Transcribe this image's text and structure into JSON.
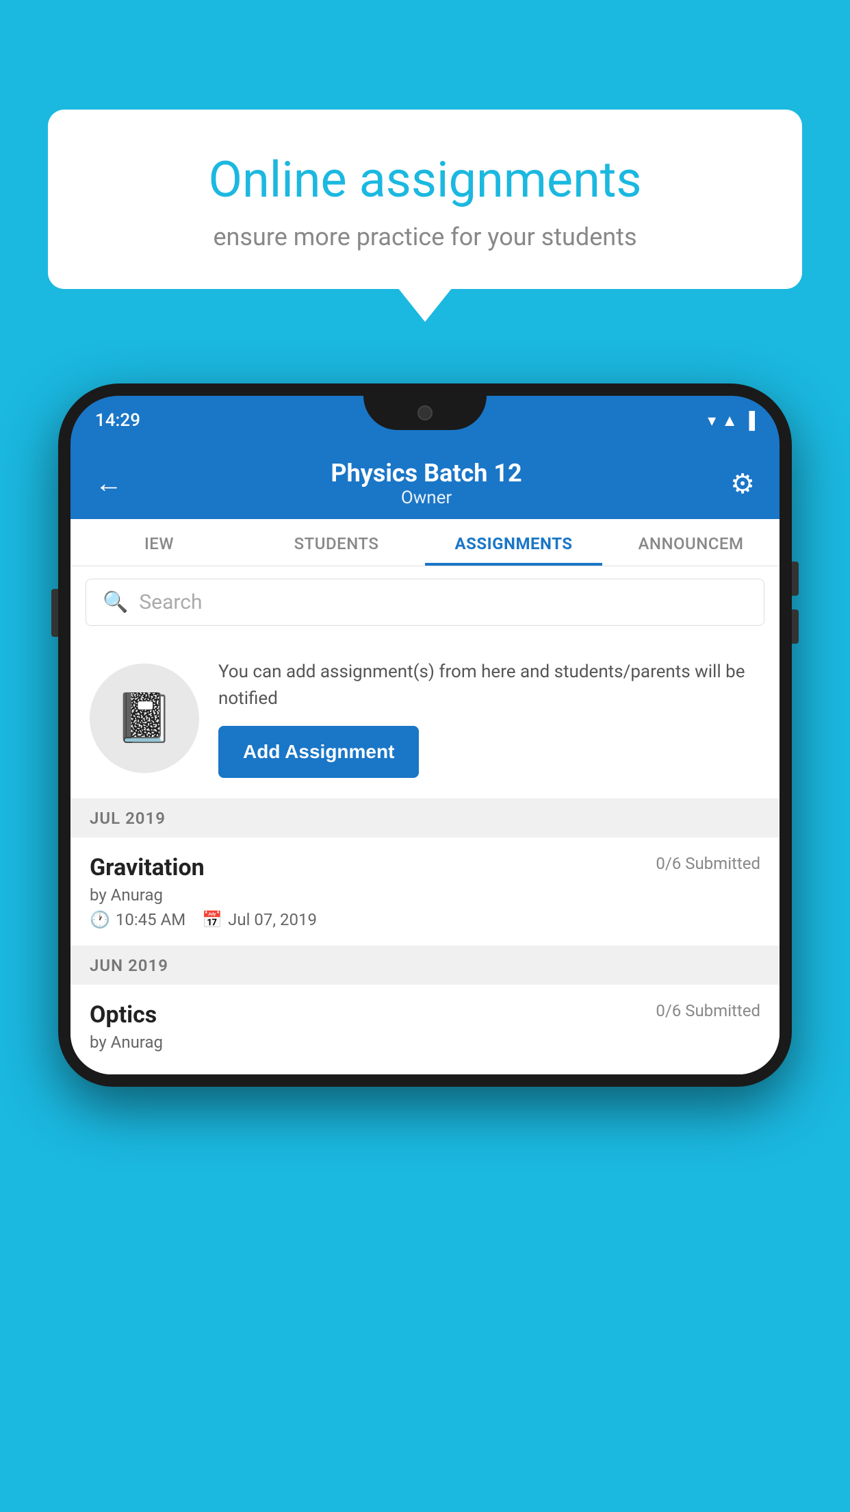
{
  "background_color": "#1bb8e0",
  "speech_bubble": {
    "title": "Online assignments",
    "subtitle": "ensure more practice for your students"
  },
  "phone": {
    "status_bar": {
      "time": "14:29",
      "icons": [
        "wifi",
        "signal",
        "battery"
      ]
    },
    "header": {
      "title": "Physics Batch 12",
      "subtitle": "Owner",
      "back_label": "←",
      "settings_label": "⚙"
    },
    "tabs": [
      {
        "label": "IEW",
        "active": false
      },
      {
        "label": "STUDENTS",
        "active": false
      },
      {
        "label": "ASSIGNMENTS",
        "active": true
      },
      {
        "label": "ANNOUNCEM",
        "active": false
      }
    ],
    "search": {
      "placeholder": "Search"
    },
    "add_assignment_section": {
      "description": "You can add assignment(s) from here and students/parents will be notified",
      "button_label": "Add Assignment"
    },
    "assignment_groups": [
      {
        "month_label": "JUL 2019",
        "assignments": [
          {
            "title": "Gravitation",
            "submitted": "0/6 Submitted",
            "author": "by Anurag",
            "time": "10:45 AM",
            "date": "Jul 07, 2019"
          }
        ]
      },
      {
        "month_label": "JUN 2019",
        "assignments": [
          {
            "title": "Optics",
            "submitted": "0/6 Submitted",
            "author": "by Anurag",
            "time": "",
            "date": ""
          }
        ]
      }
    ]
  }
}
